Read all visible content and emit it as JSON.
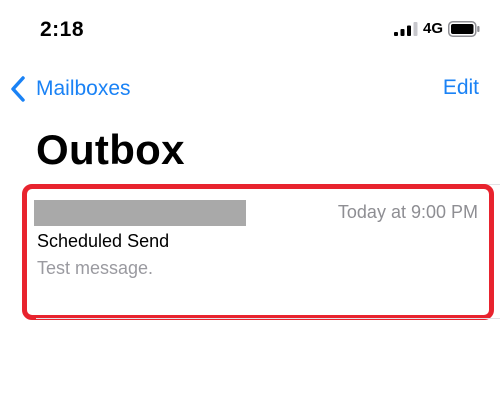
{
  "status_bar": {
    "time": "2:18",
    "network": "4G",
    "icons": [
      "signal-icon",
      "battery-icon"
    ]
  },
  "nav": {
    "back_label": "Mailboxes",
    "back_icon": "chevron-left-icon",
    "edit_label": "Edit"
  },
  "page": {
    "title": "Outbox"
  },
  "mail_list": [
    {
      "date": "Today at 9:00 PM",
      "subject": "Scheduled Send",
      "preview": "Test message."
    }
  ],
  "colors": {
    "accent": "#1a82f5",
    "highlight": "#e8232e",
    "secondary_text": "#8e8e93",
    "redaction": "#a9a9a9"
  }
}
